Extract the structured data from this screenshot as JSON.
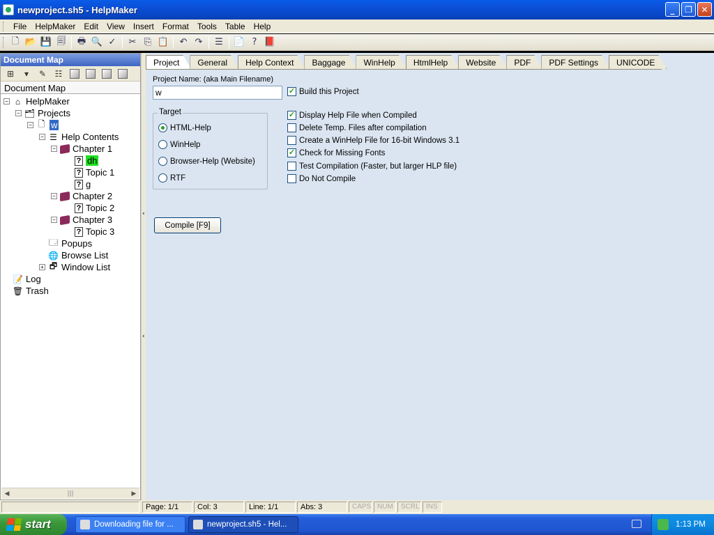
{
  "window": {
    "title": "newproject.sh5 - HelpMaker"
  },
  "menu": [
    "File",
    "HelpMaker",
    "Edit",
    "View",
    "Insert",
    "Format",
    "Tools",
    "Table",
    "Help"
  ],
  "left_pane": {
    "header": "Document Map",
    "map_label": "Document Map",
    "tree": [
      {
        "label": "HelpMaker",
        "icon": "home-icon"
      },
      {
        "label": "Projects",
        "icon": "projects-icon"
      },
      {
        "label": "w",
        "icon": "project-icon"
      },
      {
        "label": "Help Contents",
        "icon": "contents-icon"
      },
      {
        "label": "Chapter 1",
        "icon": "book-icon"
      },
      {
        "label": "dh",
        "icon": "topic-icon"
      },
      {
        "label": "Topic 1",
        "icon": "topic-icon"
      },
      {
        "label": "g",
        "icon": "topic-icon"
      },
      {
        "label": "Chapter 2",
        "icon": "book-icon"
      },
      {
        "label": "Topic 2",
        "icon": "topic-icon"
      },
      {
        "label": "Chapter 3",
        "icon": "book-icon"
      },
      {
        "label": "Topic 3",
        "icon": "topic-icon"
      },
      {
        "label": "Popups",
        "icon": "popups-icon"
      },
      {
        "label": "Browse List",
        "icon": "browse-icon"
      },
      {
        "label": "Window List",
        "icon": "window-list-icon"
      },
      {
        "label": "Log",
        "icon": "log-icon"
      },
      {
        "label": "Trash",
        "icon": "trash-icon"
      }
    ]
  },
  "tabs": [
    "Project",
    "General",
    "Help Context",
    "Baggage",
    "WinHelp",
    "HtmlHelp",
    "Website",
    "PDF",
    "PDF Settings",
    "UNICODE"
  ],
  "active_tab": "Project",
  "project": {
    "name_label": "Project Name: (aka Main Filename)",
    "name_value": "w",
    "build_label": "Build this Project",
    "target_label": "Target",
    "targets": [
      "HTML-Help",
      "WinHelp",
      "Browser-Help (Website)",
      "RTF"
    ],
    "selected_target": "HTML-Help",
    "options": [
      {
        "label": "Display Help File when Compiled",
        "checked": true
      },
      {
        "label": "Delete Temp. Files after compilation",
        "checked": false
      },
      {
        "label": "Create a WinHelp File for 16-bit Windows 3.1",
        "checked": false
      },
      {
        "label": "Check for Missing Fonts",
        "checked": true
      },
      {
        "label": "Test Compilation (Faster, but larger HLP file)",
        "checked": false
      },
      {
        "label": "Do Not Compile",
        "checked": false
      }
    ],
    "compile_button": "Compile [F9]"
  },
  "status": {
    "page": "Page: 1/1",
    "col": "Col: 3",
    "line": "Line: 1/1",
    "abs": "Abs: 3",
    "caps": "CAPS",
    "num": "NUM",
    "scrl": "SCRL",
    "ins": "INS"
  },
  "taskbar": {
    "start": "start",
    "items": [
      "Downloading file for ...",
      "newproject.sh5 - Hel..."
    ],
    "clock": "1:13 PM"
  }
}
